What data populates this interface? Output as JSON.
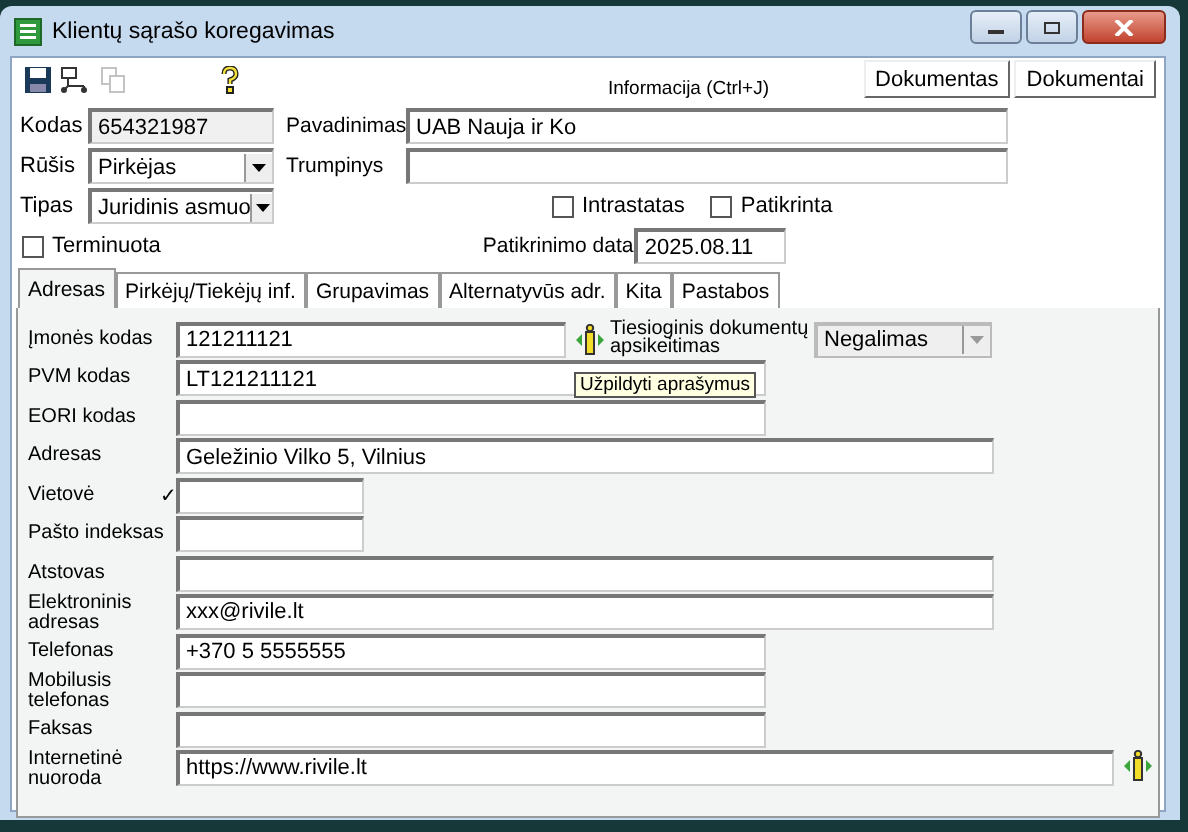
{
  "window": {
    "title": "Klientų sąrašo koregavimas"
  },
  "toolbar": {
    "buttons": [
      {
        "kind": "save",
        "disabled": false
      },
      {
        "kind": "network",
        "disabled": false
      },
      {
        "kind": "copy",
        "disabled": true
      },
      {
        "kind": "help",
        "disabled": false
      }
    ],
    "info": "Informacija (Ctrl+J)",
    "actions": [
      "Dokumentas",
      "Dokumentai"
    ]
  },
  "header": {
    "code": {
      "label": "Kodas",
      "value": "654321987"
    },
    "name": {
      "label": "Pavadinimas",
      "value": "UAB Nauja ir Ko"
    },
    "kind": {
      "label": "Rūšis",
      "value": "Pirkėjas"
    },
    "short_name": {
      "label": "Trumpinys"
    },
    "type": {
      "label": "Tipas",
      "value": "Juridinis asmuo"
    },
    "intrastat": {
      "label": "Intrastatas",
      "checked": false
    },
    "verified": {
      "label": "Patikrinta",
      "checked": false
    },
    "terminated": {
      "label": "Terminuota",
      "checked": false
    },
    "verified_date": {
      "label": "Patikrinimo data",
      "value": "2025.08.11"
    }
  },
  "tabs": [
    {
      "label": "Adresas",
      "selected": true
    },
    {
      "label": "Pirkėjų/Tiekėjų inf.",
      "selected": false
    },
    {
      "label": "Grupavimas",
      "selected": false
    },
    {
      "label": "Alternatyvūs adr.",
      "selected": false
    },
    {
      "label": "Kita",
      "selected": false
    },
    {
      "label": "Pastabos",
      "selected": false
    }
  ],
  "address": {
    "fields": [
      {
        "label": "Įmonės kodas",
        "value": "121211121"
      },
      {
        "label": "PVM kodas",
        "value": "LT121211121"
      },
      {
        "label": "EORI kodas"
      },
      {
        "label": "Adresas",
        "value": "Geležinio Vilko 5, Vilnius"
      },
      {
        "label": "Vietovė",
        "marker": "✓"
      },
      {
        "label": "Pašto indeksas"
      },
      {
        "label": "Atstovas"
      },
      {
        "label": "Elektroninis adresas",
        "value": "xxx@rivile.lt"
      },
      {
        "label": "Telefonas",
        "value": "+370 5 5555555"
      },
      {
        "label": "Mobilusis telefonas"
      },
      {
        "label": "Faksas"
      },
      {
        "label": "Internetinė nuoroda",
        "value": "https://www.rivile.lt"
      }
    ],
    "exchange": {
      "label": "Tiesioginis dokumentų apsikeitimas",
      "value": "Negalimas",
      "disabled": true
    },
    "tooltip": "Užpildyti aprašymus"
  }
}
